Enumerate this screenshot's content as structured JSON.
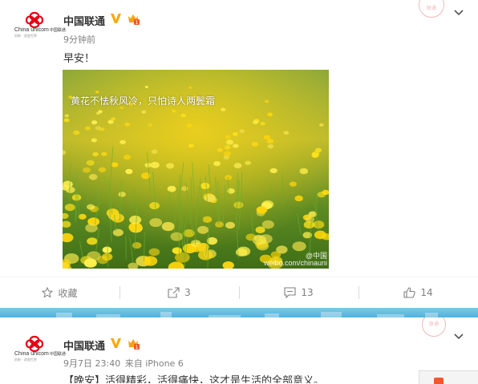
{
  "colors": {
    "accent": "#eb7350",
    "verified": "#ffa600",
    "link": "#eb7350"
  },
  "posts": [
    {
      "avatar": {
        "brand_cn": "中国联通",
        "brand_en": "China unicom",
        "slogan": "创新 · 改变世界"
      },
      "author": "中国联通",
      "verified_icon": "verified-v-icon",
      "badge_icon": "vip-badge-icon",
      "stamp": "联通",
      "time": "9分钟前",
      "text": "早安！",
      "image": {
        "poem": "黄花不怯秋风冷，只怕诗人两鬓霜",
        "watermark_1": "@中国",
        "watermark_2": "weibo.com/chinauni"
      },
      "actions": [
        {
          "icon": "star-icon",
          "label": "收藏"
        },
        {
          "icon": "share-icon",
          "label": "3"
        },
        {
          "icon": "comment-icon",
          "label": "13"
        },
        {
          "icon": "thumbs-up-icon",
          "label": "14"
        }
      ]
    },
    {
      "avatar": {
        "brand_cn": "中国联通",
        "brand_en": "China unicom",
        "slogan": "创新 · 改变世界"
      },
      "author": "中国联通",
      "stamp": "联通",
      "time": "9月7日 23:40",
      "source": "来自 iPhone 6",
      "text": "【晚安】活得精彩，活得痛快，这才是生活的全部意义。"
    }
  ]
}
